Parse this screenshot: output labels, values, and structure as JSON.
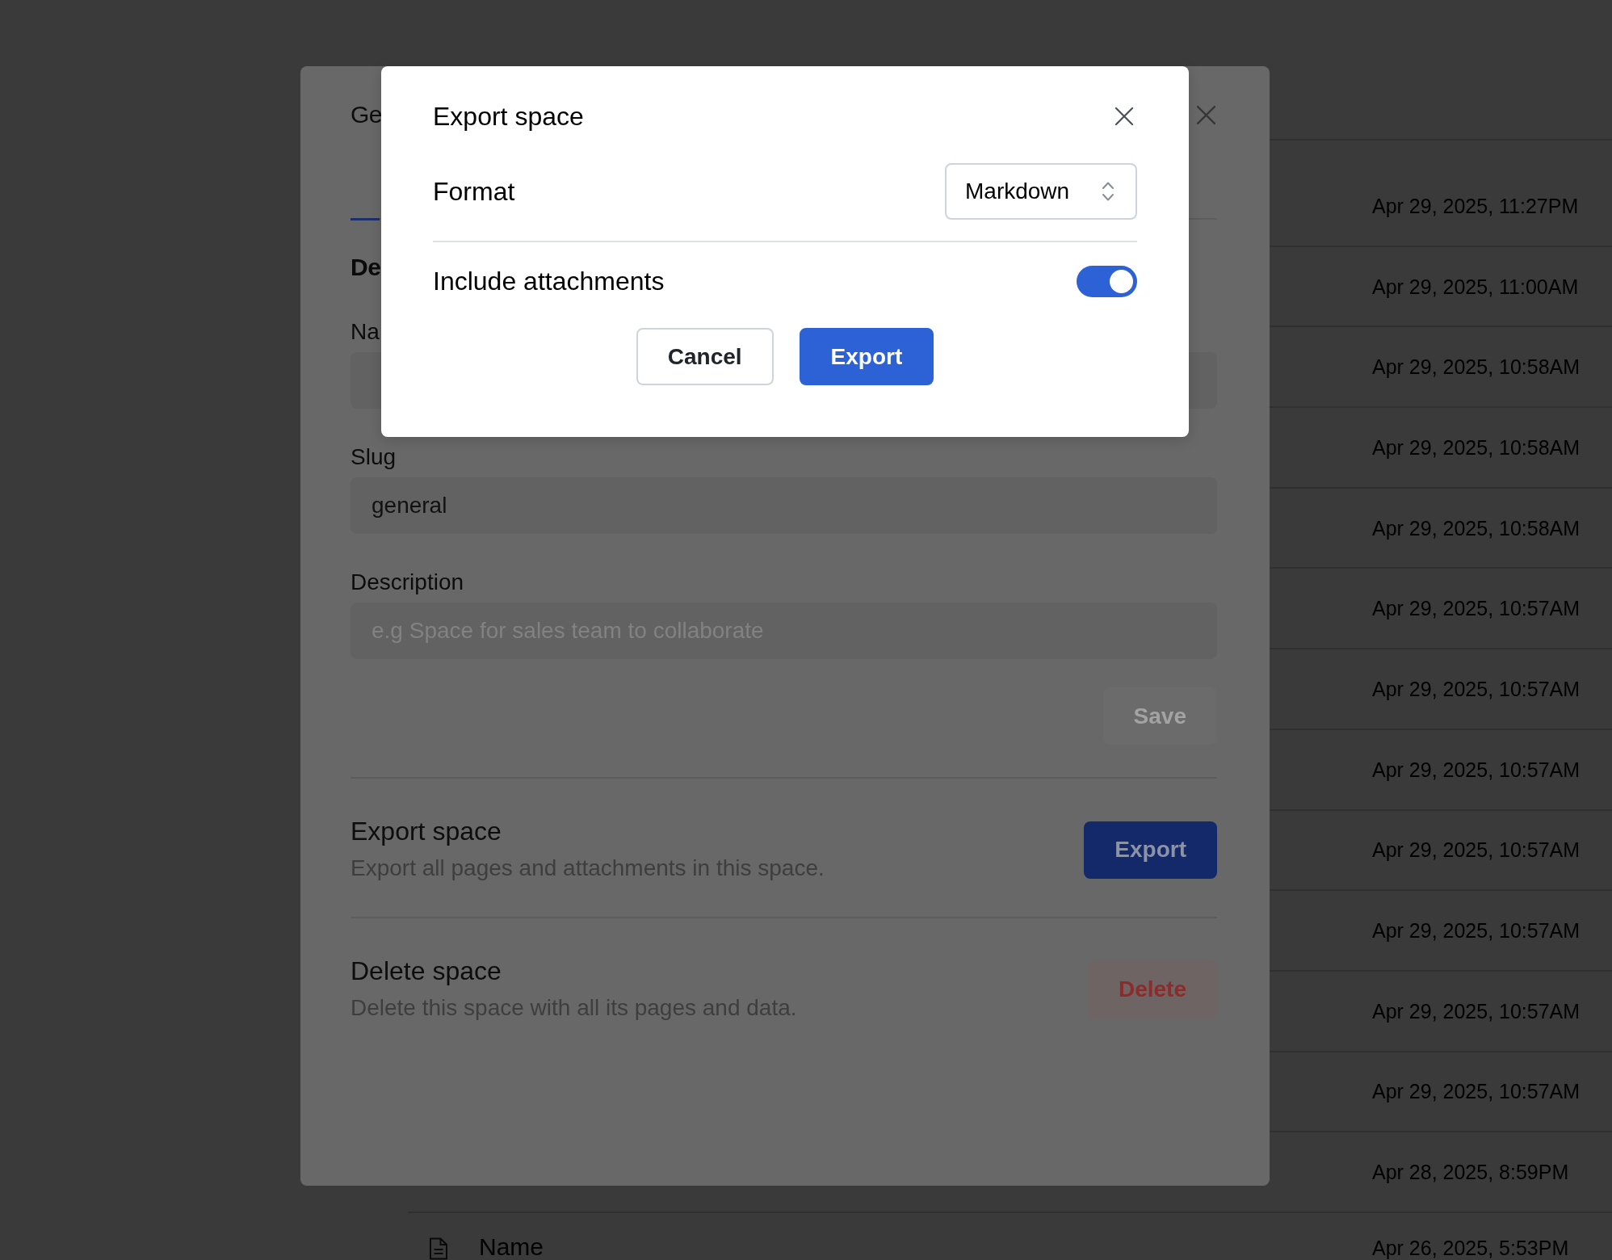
{
  "table": {
    "rows": [
      {
        "updated": "Apr 29, 2025, 11:27PM"
      },
      {
        "updated": "Apr 29, 2025, 11:00AM"
      },
      {
        "updated": "Apr 29, 2025, 10:58AM"
      },
      {
        "updated": "Apr 29, 2025, 10:58AM"
      },
      {
        "updated": "Apr 29, 2025, 10:58AM"
      },
      {
        "updated": "Apr 29, 2025, 10:57AM"
      },
      {
        "updated": "Apr 29, 2025, 10:57AM"
      },
      {
        "updated": "Apr 29, 2025, 10:57AM"
      },
      {
        "updated": "Apr 29, 2025, 10:57AM"
      },
      {
        "updated": "Apr 29, 2025, 10:57AM"
      },
      {
        "updated": "Apr 29, 2025, 10:57AM"
      },
      {
        "updated": "Apr 29, 2025, 10:57AM"
      },
      {
        "updated": "Apr 28, 2025, 8:59PM"
      },
      {
        "title": "Name",
        "updated": "Apr 26, 2025, 5:53PM"
      }
    ]
  },
  "settings_modal": {
    "title": "Ge",
    "tabs": [
      {
        "selected": true
      }
    ],
    "section_heading": "De",
    "fields": [
      {
        "label": "Na"
      },
      {
        "label": "Slug",
        "value": "general"
      },
      {
        "label": "Description",
        "placeholder": "e.g Space for sales team to collaborate"
      }
    ],
    "save_button": {
      "label": "Save",
      "disabled": true
    },
    "actions": [
      {
        "kind": "export",
        "title": "Export space",
        "description": "Export all pages and attachments in this space.",
        "button": "Export"
      },
      {
        "kind": "danger",
        "title": "Delete space",
        "description": "Delete this space with all its pages and data.",
        "button": "Delete"
      }
    ]
  },
  "export_dialog": {
    "title": "Export space",
    "format": {
      "label": "Format",
      "value": "Markdown"
    },
    "include_attachments": {
      "label": "Include attachments",
      "on": true
    },
    "buttons": [
      {
        "kind": "secondary",
        "label": "Cancel"
      },
      {
        "kind": "primary",
        "label": "Export"
      }
    ]
  }
}
